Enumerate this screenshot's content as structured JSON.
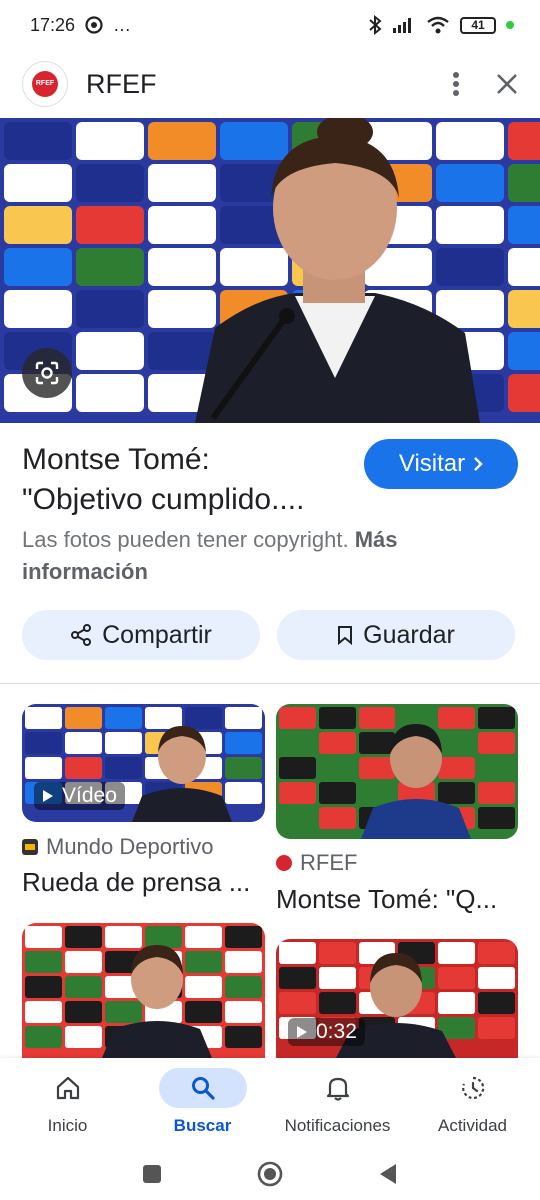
{
  "status_bar": {
    "time": "17:26",
    "extra_icon": "…",
    "battery": "41"
  },
  "header": {
    "site_logo_text": "RFEF",
    "site_name": "RFEF"
  },
  "result": {
    "title_line1": "Montse Tomé:",
    "title_line2": "\"Objetivo cumplido....",
    "visit_label": "Visitar",
    "copyright_text": "Las fotos pueden tener copyright.",
    "more_info": "Más información",
    "share_label": "Compartir",
    "save_label": "Guardar"
  },
  "related": [
    {
      "source": "Mundo Deportivo",
      "caption": "Rueda de prensa ...",
      "badge": "Vídeo"
    },
    {
      "source": "RFEF",
      "caption": "Montse Tomé: \"Q..."
    },
    {
      "source": "",
      "caption": ""
    },
    {
      "source": "",
      "caption": "",
      "badge": "0:32"
    }
  ],
  "bottom_nav": {
    "items": [
      {
        "label": "Inicio",
        "icon": "home-icon"
      },
      {
        "label": "Buscar",
        "icon": "search-icon"
      },
      {
        "label": "Notificaciones",
        "icon": "bell-icon"
      },
      {
        "label": "Actividad",
        "icon": "history-icon"
      }
    ]
  },
  "colors": {
    "accent": "#1a73e8",
    "active_nav": "#0b57d0",
    "chip_bg": "#e8f0fe"
  }
}
